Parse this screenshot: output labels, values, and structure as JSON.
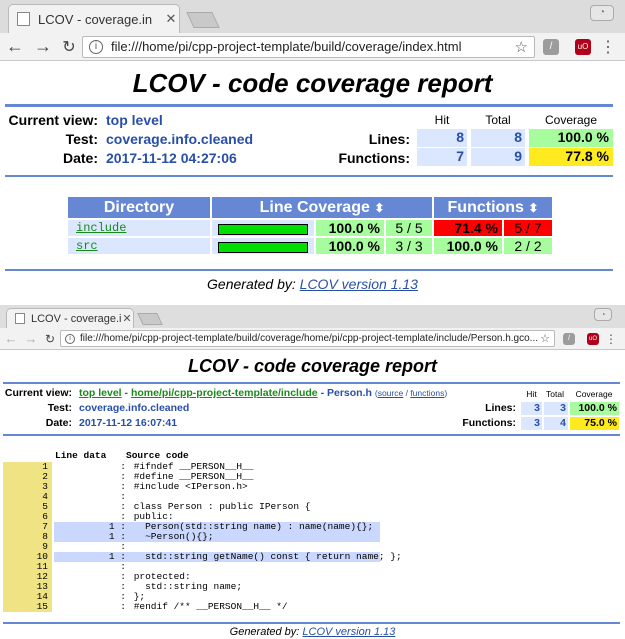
{
  "window1": {
    "tab_title": "LCOV - coverage.in",
    "url": "file:///home/pi/cpp-project-template/build/coverage/index.html"
  },
  "window2": {
    "tab_title": "LCOV - coverage.in",
    "url": "file:///home/pi/cpp-project-template/build/coverage/home/pi/cpp-project-template/include/Person.h.gco..."
  },
  "report1": {
    "title": "LCOV - code coverage report",
    "current_view_label": "Current view:",
    "current_view": "top level",
    "test_label": "Test:",
    "test": "coverage.info.cleaned",
    "date_label": "Date:",
    "date": "2017-11-12 04:27:06",
    "hit_label": "Hit",
    "total_label": "Total",
    "coverage_label": "Coverage",
    "lines_label": "Lines:",
    "lines_hit": "8",
    "lines_total": "8",
    "lines_cov": "100.0 %",
    "functions_label": "Functions:",
    "functions_hit": "7",
    "functions_total": "9",
    "functions_cov": "77.8 %",
    "col_directory": "Directory",
    "col_line_coverage": "Line Coverage",
    "col_functions": "Functions",
    "sort_icon": "⬍",
    "rows": [
      {
        "name": "include",
        "line_pct": "100.0 %",
        "line_frac": "5 / 5",
        "line_ratio": 1.0,
        "func_pct": "71.4 %",
        "func_frac": "5 / 7"
      },
      {
        "name": "src",
        "line_pct": "100.0 %",
        "line_frac": "3 / 3",
        "line_ratio": 1.0,
        "func_pct": "100.0 %",
        "func_frac": "2 / 2"
      }
    ],
    "generated_label": "Generated by:",
    "generated_link": "LCOV version 1.13"
  },
  "report2": {
    "title": "LCOV - code coverage report",
    "current_view_label": "Current view:",
    "crumb1": "top level",
    "crumb_sep": " - ",
    "crumb2": "home/pi/cpp-project-template/include",
    "crumb3": "Person.h",
    "source_link": "source",
    "functions_link": "functions",
    "test_label": "Test:",
    "test": "coverage.info.cleaned",
    "date_label": "Date:",
    "date": "2017-11-12 16:07:41",
    "hit_label": "Hit",
    "total_label": "Total",
    "coverage_label": "Coverage",
    "lines_label": "Lines:",
    "lines_hit": "3",
    "lines_total": "3",
    "lines_cov": "100.0 %",
    "functions_label": "Functions:",
    "functions_hit": "3",
    "functions_total": "4",
    "functions_cov": "75.0 %",
    "line_data_header": "Line data",
    "source_code_header": "Source code",
    "source": [
      {
        "n": "1",
        "d": ":",
        "c": " #ifndef __PERSON__H__",
        "hit": false
      },
      {
        "n": "2",
        "d": ":",
        "c": " #define __PERSON__H__",
        "hit": false
      },
      {
        "n": "3",
        "d": ":",
        "c": " #include <IPerson.h>",
        "hit": false
      },
      {
        "n": "4",
        "d": ":",
        "c": "",
        "hit": false
      },
      {
        "n": "5",
        "d": ":",
        "c": " class Person : public IPerson {",
        "hit": false
      },
      {
        "n": "6",
        "d": ":",
        "c": " public:",
        "hit": false
      },
      {
        "n": "7",
        "d": "1 :",
        "c": "   Person(std::string name) : name(name){};",
        "hit": true
      },
      {
        "n": "8",
        "d": "1 :",
        "c": "   ~Person(){};",
        "hit": true
      },
      {
        "n": "9",
        "d": ":",
        "c": "",
        "hit": false
      },
      {
        "n": "10",
        "d": "1 :",
        "c": "   std::string getName() const { return name; };",
        "hit": true
      },
      {
        "n": "11",
        "d": ":",
        "c": "",
        "hit": false
      },
      {
        "n": "12",
        "d": ":",
        "c": " protected:",
        "hit": false
      },
      {
        "n": "13",
        "d": ":",
        "c": "   std::string name;",
        "hit": false
      },
      {
        "n": "14",
        "d": ":",
        "c": " };",
        "hit": false
      },
      {
        "n": "15",
        "d": ":",
        "c": " #endif /** __PERSON__H__ */",
        "hit": false
      }
    ],
    "generated_label": "Generated by:",
    "generated_link": "LCOV version 1.13"
  },
  "colors": {
    "ruler": "#6688d4",
    "hit_green": "#a7fc9d",
    "medium_yellow": "#ffea20",
    "low_red": "#ff0000",
    "num_bg": "#dae7fe"
  }
}
